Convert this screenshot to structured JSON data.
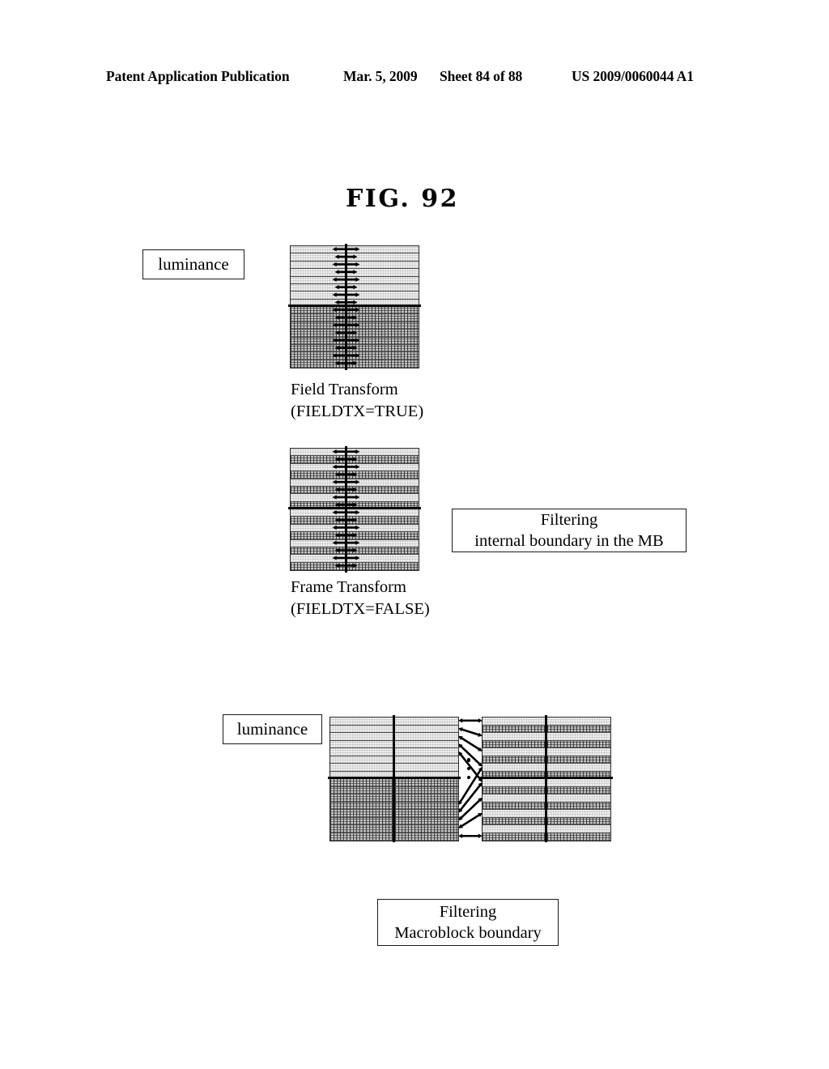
{
  "header": {
    "title": "Patent Application Publication",
    "date": "Mar. 5, 2009",
    "sheet": "Sheet 84 of 88",
    "publication_number": "US 2009/0060044 A1"
  },
  "figure": {
    "title": "FIG. 92"
  },
  "upper_section": {
    "luminance_label": "luminance",
    "field_block": {
      "caption_line1": "Field Transform",
      "caption_line2": "(FIELDTX=TRUE)",
      "rows": 16,
      "pattern": "top-half-light-bottom-half-dark",
      "arrow_count": 16
    },
    "frame_block": {
      "caption_line1": "Frame Transform",
      "caption_line2": "(FIELDTX=FALSE)",
      "rows": 16,
      "pattern": "alternating-light-dark",
      "arrow_count": 16
    },
    "filtering_box": {
      "line1": "Filtering",
      "line2": "internal boundary in the MB"
    }
  },
  "lower_section": {
    "luminance_label": "luminance",
    "left_block": {
      "rows": 16,
      "pattern": "top-half-light-bottom-half-dark"
    },
    "right_block": {
      "rows": 16,
      "pattern": "alternating-light-dark"
    },
    "ellipsis_dots": 3,
    "filtering_box": {
      "line1": "Filtering",
      "line2": "Macroblock boundary"
    }
  },
  "colors": {
    "ink": "#000000",
    "light_row": "#efefef",
    "dark_row": "#bdbdbd",
    "rule": "#4a4a4a"
  }
}
